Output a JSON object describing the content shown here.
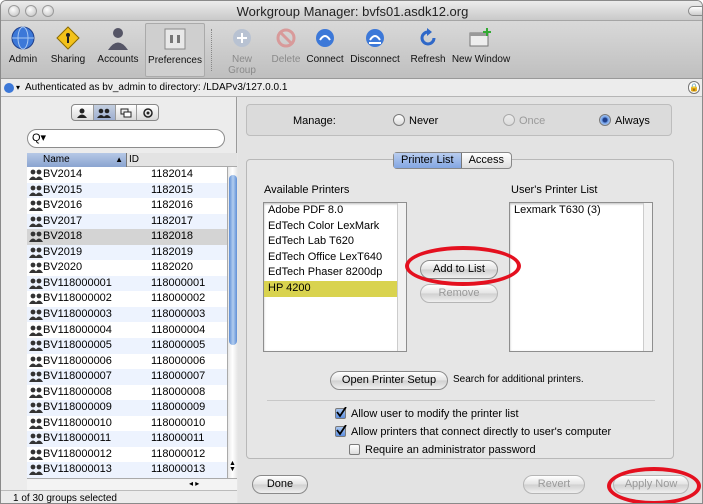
{
  "window": {
    "title": "Workgroup Manager: bvfs01.asdk12.org"
  },
  "toolbar": {
    "admin": "Admin",
    "sharing": "Sharing",
    "accounts": "Accounts",
    "preferences": "Preferences",
    "new_group": "New Group",
    "delete": "Delete",
    "connect": "Connect",
    "disconnect": "Disconnect",
    "refresh": "Refresh",
    "new_window": "New Window"
  },
  "auth": {
    "text": "Authenticated as bv_admin to directory: /LDAPv3/127.0.0.1"
  },
  "left": {
    "search_value": "",
    "col_name": "Name",
    "col_id": "ID",
    "rows": [
      {
        "name": "BV2014",
        "id": "1182014"
      },
      {
        "name": "BV2015",
        "id": "1182015"
      },
      {
        "name": "BV2016",
        "id": "1182016"
      },
      {
        "name": "BV2017",
        "id": "1182017"
      },
      {
        "name": "BV2018",
        "id": "1182018"
      },
      {
        "name": "BV2019",
        "id": "1182019"
      },
      {
        "name": "BV2020",
        "id": "1182020"
      },
      {
        "name": "BV118000001",
        "id": "118000001"
      },
      {
        "name": "BV118000002",
        "id": "118000002"
      },
      {
        "name": "BV118000003",
        "id": "118000003"
      },
      {
        "name": "BV118000004",
        "id": "118000004"
      },
      {
        "name": "BV118000005",
        "id": "118000005"
      },
      {
        "name": "BV118000006",
        "id": "118000006"
      },
      {
        "name": "BV118000007",
        "id": "118000007"
      },
      {
        "name": "BV118000008",
        "id": "118000008"
      },
      {
        "name": "BV118000009",
        "id": "118000009"
      },
      {
        "name": "BV118000010",
        "id": "118000010"
      },
      {
        "name": "BV118000011",
        "id": "118000011"
      },
      {
        "name": "BV118000012",
        "id": "118000012"
      },
      {
        "name": "BV118000013",
        "id": "118000013"
      }
    ],
    "selected_row": "BV2018",
    "status": "1 of 30 groups selected"
  },
  "manage": {
    "label": "Manage:",
    "never": "Never",
    "once": "Once",
    "always": "Always",
    "selected": "Always"
  },
  "tabs": {
    "printer_list": "Printer List",
    "access": "Access",
    "active": "Printer List"
  },
  "printers": {
    "available_label": "Available Printers",
    "user_label": "User's Printer List",
    "available": [
      "Adobe PDF 8.0",
      "EdTech Color LexMark",
      "EdTech Lab T620",
      "EdTech Office LexT640",
      "EdTech Phaser 8200dp",
      "HP 4200"
    ],
    "selected": "HP 4200",
    "user": [
      "Lexmark T630 (3)"
    ]
  },
  "buttons": {
    "add": "Add to List",
    "remove": "Remove",
    "open_setup": "Open Printer Setup",
    "setup_hint": "Search for additional printers.",
    "done": "Done",
    "revert": "Revert",
    "apply": "Apply Now"
  },
  "options": {
    "allow_modify": "Allow user to modify the printer list",
    "allow_direct": "Allow printers that connect directly to user's computer",
    "require_admin": "Require an administrator password"
  },
  "colors": {
    "highlight_ring": "#e4101f",
    "selection": "#d9d34f",
    "accent": "#5f8fd6"
  }
}
